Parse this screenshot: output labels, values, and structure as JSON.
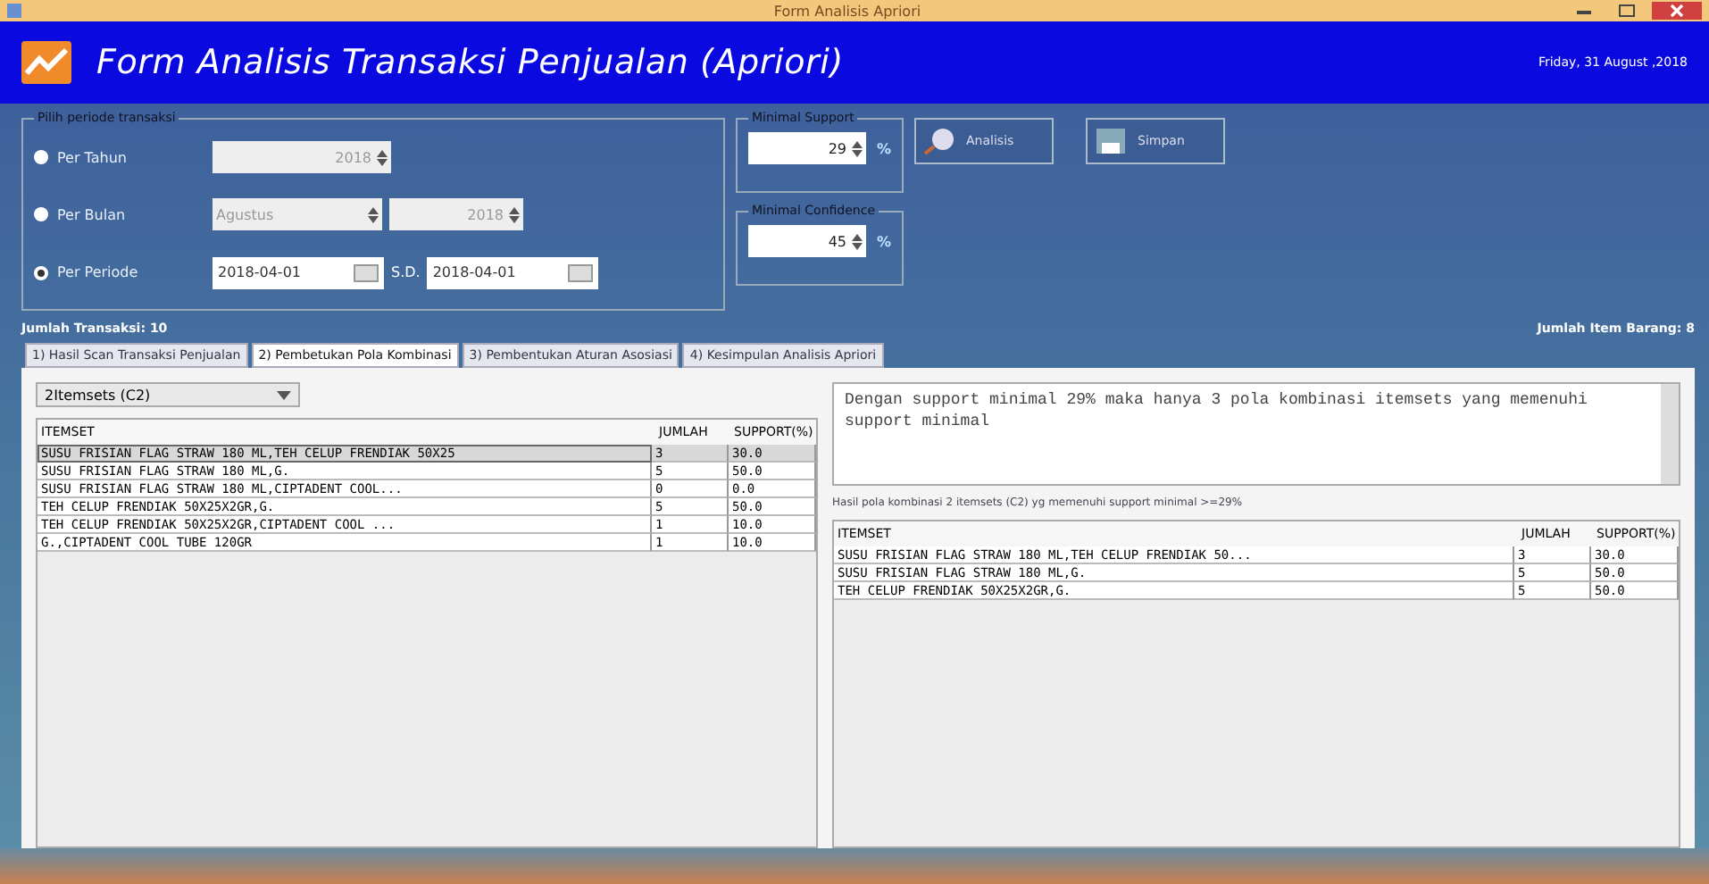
{
  "window": {
    "title": "Form Analisis Apriori"
  },
  "header": {
    "title": "Form Analisis Transaksi Penjualan (Apriori)",
    "date": "Friday, 31 August ,2018"
  },
  "period_group": {
    "title": "Pilih periode transaksi",
    "options": [
      {
        "label": "Per Tahun",
        "selected": false
      },
      {
        "label": "Per Bulan",
        "selected": false
      },
      {
        "label": "Per Periode",
        "selected": true
      }
    ],
    "year": "2018",
    "month": "Agustus",
    "month_year": "2018",
    "from": "2018-04-01",
    "to_label": "S.D.",
    "to": "2018-04-01"
  },
  "support_group": {
    "title": "Minimal Support",
    "value": "29",
    "unit": "%"
  },
  "confidence_group": {
    "title": "Minimal Confidence",
    "value": "45",
    "unit": "%"
  },
  "buttons": [
    {
      "label": "Analisis",
      "kind": "search"
    },
    {
      "label": "Simpan",
      "kind": "save"
    }
  ],
  "transaction_count": "Jumlah Transaksi: 10",
  "item_count": "Jumlah Item Barang: 8",
  "tabs": [
    {
      "label": "1) Hasil Scan Transaksi Penjualan",
      "selected": false
    },
    {
      "label": "2) Pembetukan Pola Kombinasi",
      "selected": true
    },
    {
      "label": "3) Pembentukan Aturan Asosiasi",
      "selected": false
    },
    {
      "label": "4) Kesimpulan Analisis Apriori",
      "selected": false
    }
  ],
  "itemset_select": "2Itemsets (C2)",
  "left_table": {
    "columns": [
      "ITEMSET",
      "JUMLAH",
      "SUPPORT(%)"
    ],
    "rows": [
      {
        "cells": [
          "SUSU FRISIAN FLAG STRAW 180 ML,TEH CELUP FRENDIAK 50X25",
          "3",
          "30.0"
        ],
        "selected": true
      },
      {
        "cells": [
          "SUSU FRISIAN FLAG STRAW 180 ML,G.",
          "5",
          "50.0"
        ],
        "selected": false
      },
      {
        "cells": [
          "SUSU FRISIAN FLAG STRAW 180 ML,CIPTADENT COOL...",
          "0",
          "0.0"
        ],
        "selected": false
      },
      {
        "cells": [
          "TEH CELUP FRENDIAK 50X25X2GR,G.",
          "5",
          "50.0"
        ],
        "selected": false
      },
      {
        "cells": [
          "TEH CELUP FRENDIAK 50X25X2GR,CIPTADENT COOL ...",
          "1",
          "10.0"
        ],
        "selected": false
      },
      {
        "cells": [
          "G.,CIPTADENT COOL TUBE 120GR",
          "1",
          "10.0"
        ],
        "selected": false
      }
    ]
  },
  "message": "Dengan support minimal 29%  maka hanya 3 pola kombinasi itemsets yang memenuhi support minimal",
  "result_caption": "Hasil pola kombinasi 2 itemsets (C2) yg memenuhi support minimal >=29%",
  "right_table": {
    "columns": [
      "ITEMSET",
      "JUMLAH",
      "SUPPORT(%)"
    ],
    "rows": [
      {
        "cells": [
          "SUSU FRISIAN FLAG STRAW 180 ML,TEH CELUP FRENDIAK 50...",
          "3",
          "30.0"
        ]
      },
      {
        "cells": [
          "SUSU FRISIAN FLAG STRAW 180 ML,G.",
          "5",
          "50.0"
        ]
      },
      {
        "cells": [
          "TEH CELUP FRENDIAK 50X25X2GR,G.",
          "5",
          "50.0"
        ]
      }
    ]
  }
}
